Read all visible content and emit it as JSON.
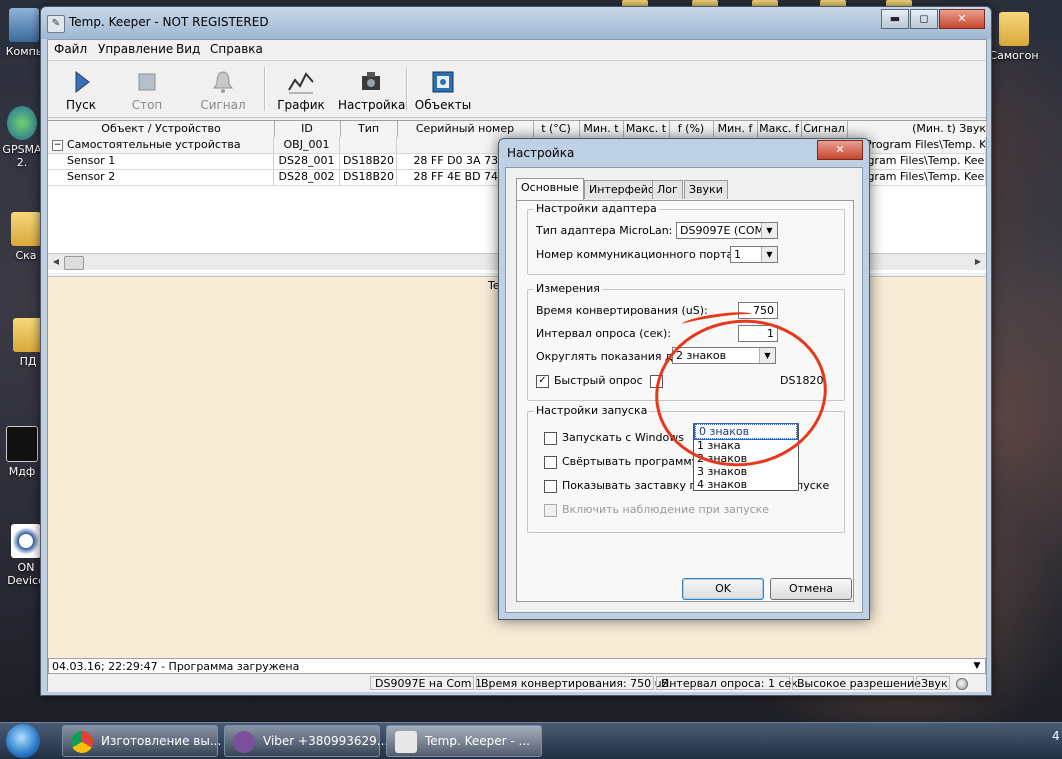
{
  "desktop": {
    "icons": [
      {
        "label": "Компь"
      },
      {
        "label": "GPSMA 2."
      },
      {
        "label": "Ска"
      },
      {
        "label": "ПД"
      },
      {
        "label": "Мдф"
      },
      {
        "label": "ON Device"
      },
      {
        "label": "Самогон"
      }
    ]
  },
  "main_window": {
    "title": "Temp. Keeper  - NOT REGISTERED",
    "controls": {
      "minimize": "▬",
      "maximize": "◻",
      "close": "✕"
    },
    "menu": [
      "Файл",
      "Управление",
      "Вид",
      "Справка"
    ],
    "toolbar": [
      {
        "label": "Пуск",
        "icon": "play-icon"
      },
      {
        "label": "Стоп",
        "icon": "stop-icon"
      },
      {
        "label": "Сигнал",
        "icon": "bell-icon"
      },
      {
        "label": "График",
        "icon": "chart-icon"
      },
      {
        "label": "Настройка",
        "icon": "settings-icon"
      },
      {
        "label": "Объекты",
        "icon": "objects-icon"
      }
    ],
    "table": {
      "columns": [
        "Объект / Устройство",
        "ID",
        "Тип",
        "Серийный номер",
        "t (°C)",
        "Мин. t",
        "Макс. t",
        "f (%)",
        "Мин. f",
        "Макс. f",
        "Сигнал",
        "(Мин. t) Звук"
      ],
      "rows": [
        {
          "name": "Самостоятельные устройства",
          "id": "OBJ_001",
          "type": "",
          "serial": "",
          "path": "C:\\Program Files\\Temp. Kee"
        },
        {
          "name": "Sensor 1",
          "id": "DS28_001",
          "type": "DS18B20",
          "serial": "28 FF D0 3A 73 15",
          "path": "Program Files\\Temp. Kee"
        },
        {
          "name": "Sensor 2",
          "id": "DS28_002",
          "type": "DS18B20",
          "serial": "28 FF 4E BD 74 15",
          "path": "Program Files\\Temp. Kee"
        }
      ]
    },
    "info_label": "Tem",
    "log": "04.03.16; 22:29:47 - Программа загружена",
    "status": [
      "DS9097E на Com 1",
      "Время конвертирования: 750 uS.",
      "Интервал опроса: 1 сек.",
      "Высокое разрешение",
      "Звук"
    ]
  },
  "dialog": {
    "title": "Настройка",
    "close": "✕",
    "tabs": [
      "Основные",
      "Интерфейс",
      "Лог",
      "Звуки"
    ],
    "adapter_group": {
      "title": "Настройки адаптера",
      "type_label": "Тип адаптера MicroLan:",
      "type_value": "DS9097E (COM)",
      "port_label": "Номер коммуникационного порта:",
      "port_value": "1"
    },
    "measure_group": {
      "title": "Измерения",
      "conv_label": "Время конвертирования (uS):",
      "conv_value": "750",
      "interval_label": "Интервал опроса (сек):",
      "interval_value": "1",
      "round_label": "Округлять показания д",
      "round_value": "2 знаков",
      "round_options": [
        "0 знаков",
        "1 знака",
        "2 знаков",
        "3 знаков",
        "4 знаков"
      ],
      "fast_label": "Быстрый опрос",
      "ds_label": "DS1820"
    },
    "startup_group": {
      "title": "Настройки запуска",
      "items": [
        {
          "label": "Запускать с Windows",
          "checked": false,
          "disabled": false
        },
        {
          "label": "Свёртывать программу при запуске",
          "checked": false,
          "disabled": false
        },
        {
          "label": "Показывать заставку программы при запуске",
          "checked": false,
          "disabled": false
        },
        {
          "label": "Включить наблюдение при запуске",
          "checked": false,
          "disabled": true
        }
      ]
    },
    "ok": "OK",
    "cancel": "Отмена"
  },
  "taskbar": {
    "items": [
      {
        "label": "Изготовление вы..."
      },
      {
        "label": "Viber +380993629..."
      },
      {
        "label": "Temp. Keeper  - ..."
      }
    ],
    "clock": "4"
  },
  "colors": {
    "accent_ring": "#e8381c",
    "info_panel": "#f7ebd5"
  }
}
